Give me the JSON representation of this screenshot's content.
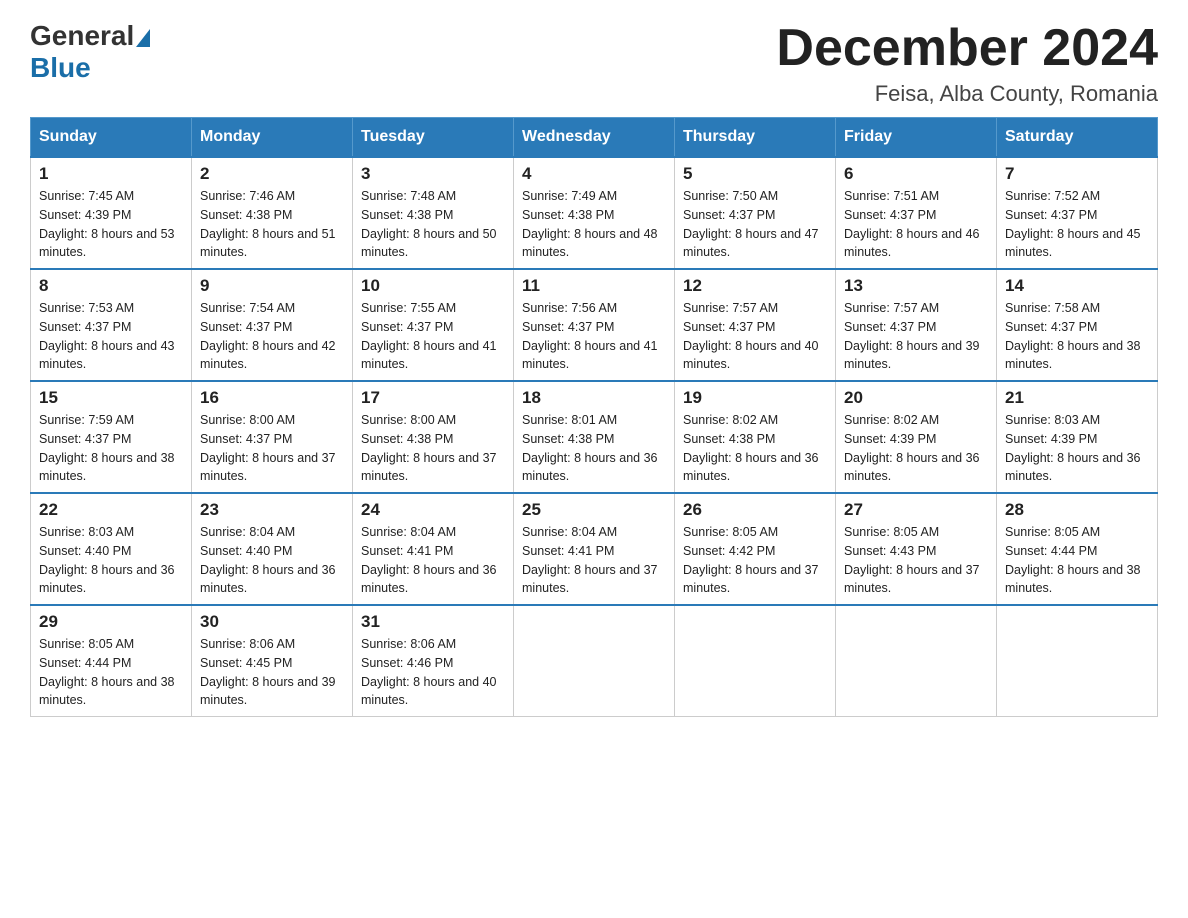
{
  "header": {
    "logo_general": "General",
    "logo_blue": "Blue",
    "title": "December 2024",
    "location": "Feisa, Alba County, Romania"
  },
  "days_of_week": [
    "Sunday",
    "Monday",
    "Tuesday",
    "Wednesday",
    "Thursday",
    "Friday",
    "Saturday"
  ],
  "weeks": [
    [
      {
        "day": 1,
        "sunrise": "7:45 AM",
        "sunset": "4:39 PM",
        "daylight": "8 hours and 53 minutes."
      },
      {
        "day": 2,
        "sunrise": "7:46 AM",
        "sunset": "4:38 PM",
        "daylight": "8 hours and 51 minutes."
      },
      {
        "day": 3,
        "sunrise": "7:48 AM",
        "sunset": "4:38 PM",
        "daylight": "8 hours and 50 minutes."
      },
      {
        "day": 4,
        "sunrise": "7:49 AM",
        "sunset": "4:38 PM",
        "daylight": "8 hours and 48 minutes."
      },
      {
        "day": 5,
        "sunrise": "7:50 AM",
        "sunset": "4:37 PM",
        "daylight": "8 hours and 47 minutes."
      },
      {
        "day": 6,
        "sunrise": "7:51 AM",
        "sunset": "4:37 PM",
        "daylight": "8 hours and 46 minutes."
      },
      {
        "day": 7,
        "sunrise": "7:52 AM",
        "sunset": "4:37 PM",
        "daylight": "8 hours and 45 minutes."
      }
    ],
    [
      {
        "day": 8,
        "sunrise": "7:53 AM",
        "sunset": "4:37 PM",
        "daylight": "8 hours and 43 minutes."
      },
      {
        "day": 9,
        "sunrise": "7:54 AM",
        "sunset": "4:37 PM",
        "daylight": "8 hours and 42 minutes."
      },
      {
        "day": 10,
        "sunrise": "7:55 AM",
        "sunset": "4:37 PM",
        "daylight": "8 hours and 41 minutes."
      },
      {
        "day": 11,
        "sunrise": "7:56 AM",
        "sunset": "4:37 PM",
        "daylight": "8 hours and 41 minutes."
      },
      {
        "day": 12,
        "sunrise": "7:57 AM",
        "sunset": "4:37 PM",
        "daylight": "8 hours and 40 minutes."
      },
      {
        "day": 13,
        "sunrise": "7:57 AM",
        "sunset": "4:37 PM",
        "daylight": "8 hours and 39 minutes."
      },
      {
        "day": 14,
        "sunrise": "7:58 AM",
        "sunset": "4:37 PM",
        "daylight": "8 hours and 38 minutes."
      }
    ],
    [
      {
        "day": 15,
        "sunrise": "7:59 AM",
        "sunset": "4:37 PM",
        "daylight": "8 hours and 38 minutes."
      },
      {
        "day": 16,
        "sunrise": "8:00 AM",
        "sunset": "4:37 PM",
        "daylight": "8 hours and 37 minutes."
      },
      {
        "day": 17,
        "sunrise": "8:00 AM",
        "sunset": "4:38 PM",
        "daylight": "8 hours and 37 minutes."
      },
      {
        "day": 18,
        "sunrise": "8:01 AM",
        "sunset": "4:38 PM",
        "daylight": "8 hours and 36 minutes."
      },
      {
        "day": 19,
        "sunrise": "8:02 AM",
        "sunset": "4:38 PM",
        "daylight": "8 hours and 36 minutes."
      },
      {
        "day": 20,
        "sunrise": "8:02 AM",
        "sunset": "4:39 PM",
        "daylight": "8 hours and 36 minutes."
      },
      {
        "day": 21,
        "sunrise": "8:03 AM",
        "sunset": "4:39 PM",
        "daylight": "8 hours and 36 minutes."
      }
    ],
    [
      {
        "day": 22,
        "sunrise": "8:03 AM",
        "sunset": "4:40 PM",
        "daylight": "8 hours and 36 minutes."
      },
      {
        "day": 23,
        "sunrise": "8:04 AM",
        "sunset": "4:40 PM",
        "daylight": "8 hours and 36 minutes."
      },
      {
        "day": 24,
        "sunrise": "8:04 AM",
        "sunset": "4:41 PM",
        "daylight": "8 hours and 36 minutes."
      },
      {
        "day": 25,
        "sunrise": "8:04 AM",
        "sunset": "4:41 PM",
        "daylight": "8 hours and 37 minutes."
      },
      {
        "day": 26,
        "sunrise": "8:05 AM",
        "sunset": "4:42 PM",
        "daylight": "8 hours and 37 minutes."
      },
      {
        "day": 27,
        "sunrise": "8:05 AM",
        "sunset": "4:43 PM",
        "daylight": "8 hours and 37 minutes."
      },
      {
        "day": 28,
        "sunrise": "8:05 AM",
        "sunset": "4:44 PM",
        "daylight": "8 hours and 38 minutes."
      }
    ],
    [
      {
        "day": 29,
        "sunrise": "8:05 AM",
        "sunset": "4:44 PM",
        "daylight": "8 hours and 38 minutes."
      },
      {
        "day": 30,
        "sunrise": "8:06 AM",
        "sunset": "4:45 PM",
        "daylight": "8 hours and 39 minutes."
      },
      {
        "day": 31,
        "sunrise": "8:06 AM",
        "sunset": "4:46 PM",
        "daylight": "8 hours and 40 minutes."
      },
      null,
      null,
      null,
      null
    ]
  ]
}
